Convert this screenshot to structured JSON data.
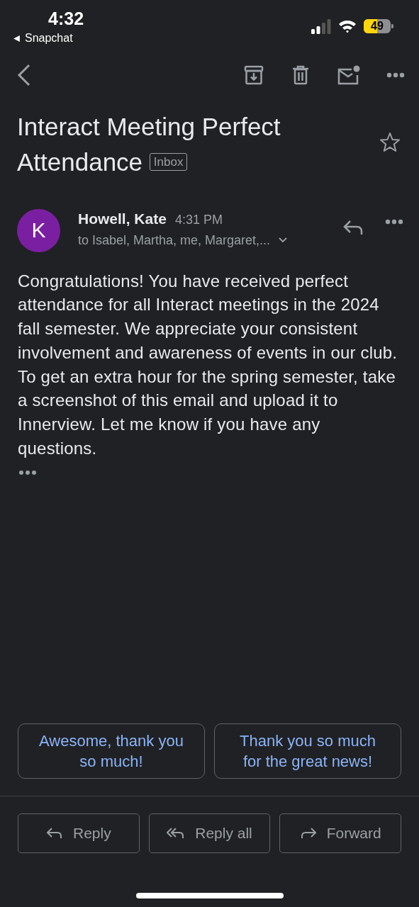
{
  "status_bar": {
    "time": "4:32",
    "back_app": "Snapchat",
    "battery": "49"
  },
  "toolbar": {
    "actions": [
      {
        "kind": "archive"
      },
      {
        "kind": "delete"
      },
      {
        "kind": "mark_unread"
      },
      {
        "kind": "more"
      }
    ]
  },
  "subject": {
    "title": "Interact Meeting Perfect Attendance",
    "label": "Inbox",
    "starred": false
  },
  "message": {
    "avatar_letter": "K",
    "sender": "Howell, Kate",
    "time": "4:31 PM",
    "recipients": "to Isabel, Martha, me, Margaret,...",
    "body": "Congratulations! You have received perfect attendance for all Interact meetings in the 2024 fall semester. We appreciate your consistent involvement and awareness of events in our club. To get an extra hour for the spring semester, take a screenshot of this email and upload it to Innerview. Let me know if you have any questions."
  },
  "smart_replies": [
    "Awesome, thank you so much!",
    "Thank you so much for the great news!"
  ],
  "actions": [
    {
      "kind": "reply",
      "label": "Reply"
    },
    {
      "kind": "reply_all",
      "label": "Reply all"
    },
    {
      "kind": "forward",
      "label": "Forward"
    }
  ]
}
